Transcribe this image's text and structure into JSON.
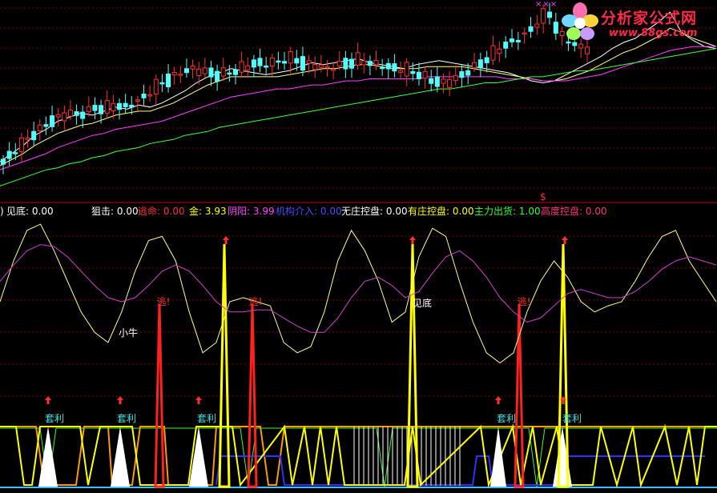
{
  "indicator_bar": {
    "paren": ")",
    "items": [
      {
        "label": "见底:",
        "value": "0.00",
        "color": "#ffffff"
      },
      {
        "label": "狙击:",
        "value": "0.00",
        "color": "#ffffff"
      },
      {
        "label": "逃命:",
        "value": "0.00",
        "color": "#ff3030"
      },
      {
        "label": "金:",
        "value": "3.93",
        "color": "#ffff00"
      },
      {
        "label": "阴阳:",
        "value": "3.99",
        "color": "#ff40ff"
      },
      {
        "label": "机构介入:",
        "value": "0.00",
        "color": "#3a3aff"
      },
      {
        "label": "无庄控盘:",
        "value": "0.00",
        "color": "#ffffff"
      },
      {
        "label": "有庄控盘:",
        "value": "0.00",
        "color": "#ffff00"
      },
      {
        "label": "主力出货:",
        "value": "1.00",
        "color": "#30ff30"
      },
      {
        "label": "高度控盘:",
        "value": "0.00",
        "color": "#ff3080"
      }
    ]
  },
  "logo": {
    "title": "分析家公式网",
    "url": "www.88gs.com",
    "marks": "×××"
  },
  "annotations": {
    "small_bull": "小牛",
    "escape": "逃!",
    "bottom": "见底",
    "arbitrage": "套利",
    "dollar": "$"
  },
  "colors": {
    "background": "#000000",
    "up_candle": "#ff3030",
    "down_candle": "#54ffff",
    "ma_short": "#ffffff",
    "ma_mid": "#ffff80",
    "ma_long": "#ff40ff",
    "ma_longest": "#40ff40",
    "osc_a": "#ffff80",
    "osc_b": "#d040d0",
    "spike_red": "#ff2020",
    "spike_yellow": "#ffff00",
    "band_green": "#30ff30",
    "band_orange": "#ff9900",
    "band_blue": "#3030ff",
    "grid": "#800000"
  },
  "chart_data": [
    {
      "type": "line",
      "series": [
        {
          "values": [
            72,
            76,
            80,
            85,
            88,
            92,
            94,
            96,
            95,
            97,
            99,
            98,
            100,
            99,
            101,
            104,
            107,
            111,
            114,
            116,
            118,
            117,
            116,
            115,
            116,
            117,
            119,
            121,
            120,
            121,
            122,
            123,
            121,
            120,
            119,
            118,
            120,
            121,
            122,
            121,
            120,
            119,
            118,
            117,
            116,
            114,
            112,
            111,
            112,
            115,
            118,
            121,
            124,
            128,
            131,
            133,
            137,
            141,
            146,
            136,
            132,
            129,
            128
          ]
        },
        {
          "values": [
            70,
            73,
            76,
            80,
            83,
            86,
            88,
            90,
            91,
            93,
            95,
            96,
            97,
            97,
            99,
            101,
            104,
            107,
            110,
            112,
            114,
            114,
            114,
            114,
            114,
            115,
            116,
            117,
            118,
            118,
            119,
            120,
            120,
            119,
            118,
            118,
            118,
            119,
            119,
            119,
            119,
            118,
            117,
            116,
            115,
            114,
            113,
            112,
            112,
            113,
            115,
            117,
            120,
            123,
            126,
            128,
            131,
            134,
            138,
            136,
            133,
            131,
            129
          ]
        },
        {
          "values": [
            68,
            70,
            72,
            74,
            76,
            79,
            81,
            83,
            85,
            86,
            88,
            89,
            90,
            91,
            92,
            94,
            96,
            98,
            100,
            102,
            104,
            105,
            106,
            107,
            108,
            108,
            109,
            110,
            110,
            111,
            112,
            112,
            113,
            113,
            113,
            113,
            113,
            114,
            114,
            114,
            114,
            114,
            114,
            114,
            113,
            113,
            113,
            112,
            112,
            112,
            113,
            114,
            115,
            117,
            119,
            121,
            123,
            125,
            127,
            128,
            129,
            129,
            129
          ]
        },
        {
          "values": [
            60,
            62,
            64,
            66,
            68,
            69,
            71,
            72,
            74,
            75,
            77,
            78,
            79,
            81,
            82,
            83,
            85,
            86,
            87,
            89,
            90,
            91,
            92,
            93,
            94,
            95,
            96,
            97,
            98,
            99,
            100,
            101,
            102,
            103,
            104,
            105,
            106,
            107,
            108,
            108,
            109,
            110,
            111,
            111,
            112,
            113,
            114,
            114,
            115,
            116,
            117,
            117,
            118,
            119,
            120,
            121,
            122,
            123,
            124,
            125,
            126,
            127,
            128
          ]
        }
      ]
    },
    {
      "type": "line",
      "series": [
        {
          "values": [
            60,
            80,
            95,
            98,
            85,
            70,
            55,
            45,
            40,
            55,
            75,
            90,
            92,
            80,
            55,
            35,
            40,
            60,
            62,
            60,
            58,
            40,
            35,
            38,
            55,
            80,
            95,
            85,
            70,
            50,
            55,
            82,
            96,
            92,
            70,
            50,
            35,
            30,
            35,
            55,
            70,
            80,
            72,
            60,
            55,
            58,
            60,
            70,
            82,
            92,
            95,
            80,
            70,
            60
          ]
        },
        {
          "values": [
            70,
            78,
            85,
            88,
            87,
            82,
            75,
            68,
            62,
            60,
            62,
            68,
            75,
            78,
            75,
            68,
            60,
            55,
            55,
            56,
            56,
            52,
            48,
            45,
            45,
            52,
            62,
            70,
            72,
            68,
            62,
            65,
            74,
            82,
            85,
            80,
            72,
            62,
            55,
            50,
            52,
            58,
            64,
            66,
            64,
            62,
            62,
            65,
            70,
            76,
            80,
            82,
            80,
            78
          ]
        }
      ]
    }
  ]
}
